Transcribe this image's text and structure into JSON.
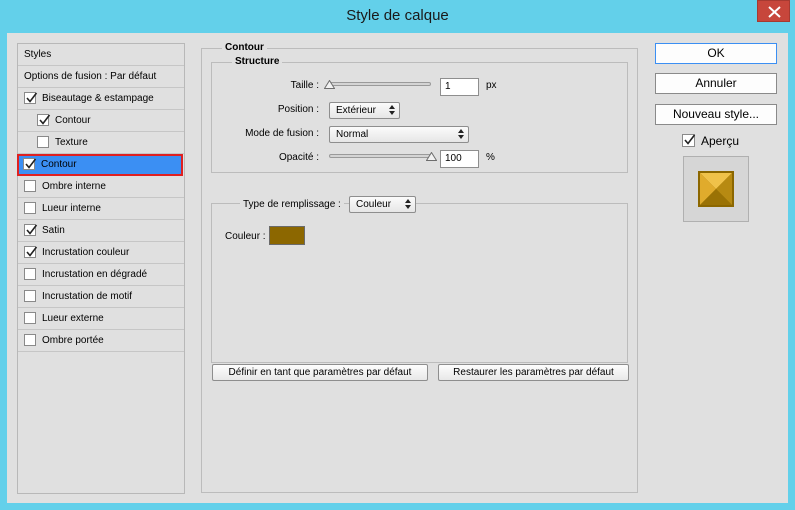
{
  "window": {
    "title": "Style de calque"
  },
  "styles_panel": {
    "header": "Styles",
    "items": [
      {
        "label": "Options de fusion : Par défaut",
        "has_checkbox": false,
        "checked": false,
        "indent": 0,
        "selected": false
      },
      {
        "label": "Biseautage & estampage",
        "has_checkbox": true,
        "checked": true,
        "indent": 0,
        "selected": false
      },
      {
        "label": "Contour",
        "has_checkbox": true,
        "checked": true,
        "indent": 1,
        "selected": false
      },
      {
        "label": "Texture",
        "has_checkbox": true,
        "checked": false,
        "indent": 1,
        "selected": false
      },
      {
        "label": "Contour",
        "has_checkbox": true,
        "checked": true,
        "indent": 0,
        "selected": true
      },
      {
        "label": "Ombre interne",
        "has_checkbox": true,
        "checked": false,
        "indent": 0,
        "selected": false
      },
      {
        "label": "Lueur interne",
        "has_checkbox": true,
        "checked": false,
        "indent": 0,
        "selected": false
      },
      {
        "label": "Satin",
        "has_checkbox": true,
        "checked": true,
        "indent": 0,
        "selected": false
      },
      {
        "label": "Incrustation couleur",
        "has_checkbox": true,
        "checked": true,
        "indent": 0,
        "selected": false
      },
      {
        "label": "Incrustation en dégradé",
        "has_checkbox": true,
        "checked": false,
        "indent": 0,
        "selected": false
      },
      {
        "label": "Incrustation de motif",
        "has_checkbox": true,
        "checked": false,
        "indent": 0,
        "selected": false
      },
      {
        "label": "Lueur externe",
        "has_checkbox": true,
        "checked": false,
        "indent": 0,
        "selected": false
      },
      {
        "label": "Ombre portée",
        "has_checkbox": true,
        "checked": false,
        "indent": 0,
        "selected": false
      }
    ]
  },
  "contour": {
    "title": "Contour",
    "structure": {
      "title": "Structure",
      "size_label": "Taille :",
      "size_value": "1",
      "size_unit": "px",
      "size_slider_fraction": 0.0,
      "position_label": "Position :",
      "position_value": "Extérieur",
      "blend_label": "Mode de fusion :",
      "blend_value": "Normal",
      "opacity_label": "Opacité :",
      "opacity_value": "100",
      "opacity_unit": "%",
      "opacity_slider_fraction": 1.0
    },
    "fill": {
      "type_label": "Type de remplissage :",
      "type_value": "Couleur",
      "color_label": "Couleur :",
      "color_hex": "#8c6700"
    },
    "buttons": {
      "set_default": "Définir en tant que paramètres par défaut",
      "reset_default": "Restaurer les paramètres par défaut"
    }
  },
  "actions": {
    "ok": "OK",
    "cancel": "Annuler",
    "new_style": "Nouveau style...",
    "preview_label": "Aperçu",
    "preview_checked": true
  }
}
